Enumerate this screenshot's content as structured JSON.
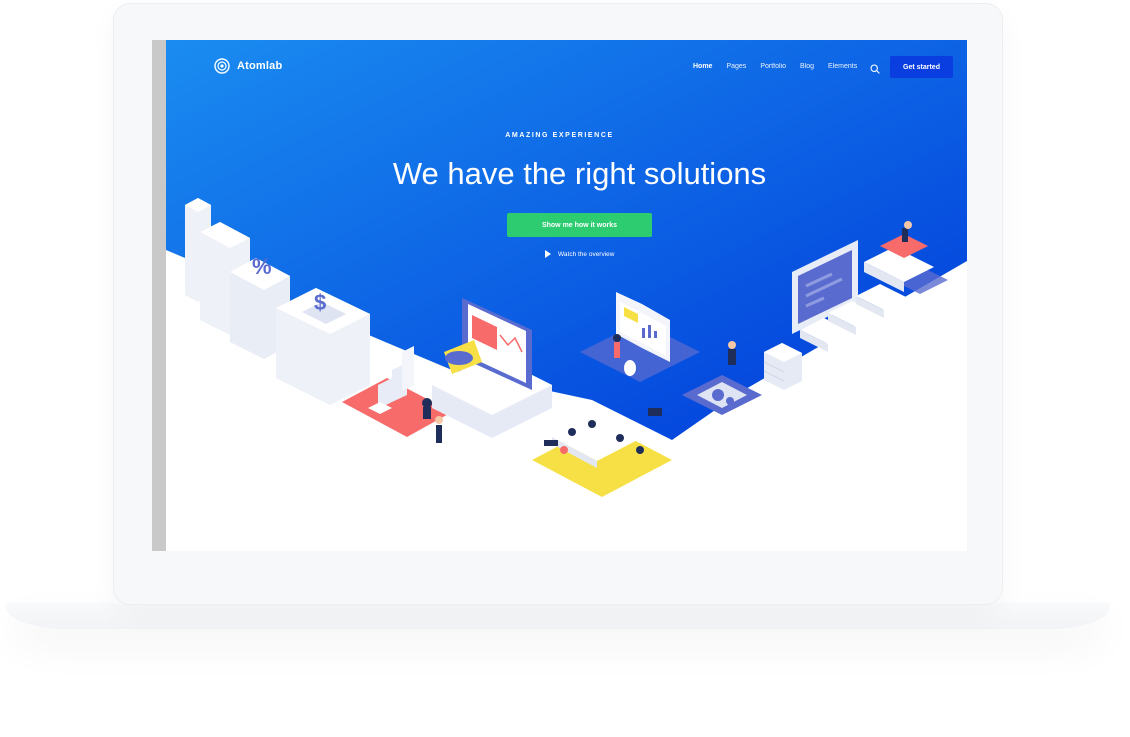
{
  "brand": {
    "name": "Atomlab"
  },
  "nav": {
    "items": [
      {
        "label": "Home",
        "active": true
      },
      {
        "label": "Pages",
        "active": false
      },
      {
        "label": "Portfolio",
        "active": false
      },
      {
        "label": "Blog",
        "active": false
      },
      {
        "label": "Elements",
        "active": false
      }
    ],
    "search_icon": "search-icon",
    "cta_label": "Get started"
  },
  "hero": {
    "eyebrow": "AMAZING EXPERIENCE",
    "headline": "We have the right solutions",
    "primary_cta": "Show me how it works",
    "secondary_cta": "Watch the overview",
    "secondary_icon": "play-icon"
  },
  "colors": {
    "hero_gradient_start": "#1a8cf0",
    "hero_gradient_end": "#0039d9",
    "cta_dark": "#0a3ee0",
    "cta_green": "#2ecc71",
    "accent_coral": "#f76b6b",
    "accent_yellow": "#f6e046",
    "accent_indigo": "#5a6bd0"
  },
  "illustration": {
    "symbols": [
      "%",
      "$"
    ]
  }
}
